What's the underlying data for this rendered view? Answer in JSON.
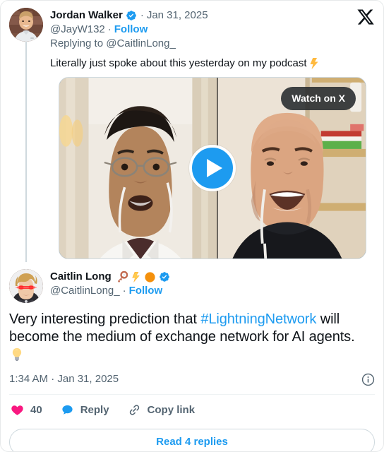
{
  "branding": {
    "logo": "x-logo"
  },
  "parent_tweet": {
    "display_name": "Jordan Walker",
    "verified": true,
    "separator": "·",
    "date": "Jan 31, 2025",
    "handle": "@JayW132",
    "follow_label": "Follow",
    "replying_to": "Replying to @CaitlinLong_",
    "body_text": "Literally just spoke about this yesterday on my podcast",
    "body_emoji": "high-voltage-emoji",
    "avatar_alt": "jordan-walker-avatar"
  },
  "video": {
    "watch_button_label": "Watch on X",
    "play_button": "play-icon",
    "left_frame_alt": "man-with-glasses-white-shirt-video-frame",
    "right_frame_alt": "bald-man-black-tshirt-video-frame"
  },
  "main_tweet": {
    "display_name": "Caitlin Long",
    "name_emojis": [
      "key-emoji",
      "high-voltage-emoji",
      "orange-circle-emoji"
    ],
    "verified": true,
    "handle": "@CaitlinLong_",
    "separator": "·",
    "follow_label": "Follow",
    "avatar_alt": "caitlin-long-avatar",
    "text_part1": "Very interesting prediction that ",
    "hashtag": "#LightningNetwork",
    "text_part2": " will become the medium of exchange network for AI agents.",
    "trailing_emoji": "light-bulb-emoji",
    "timestamp": "1:34 AM · Jan 31, 2025",
    "info_icon": "info-circle-icon"
  },
  "actions": {
    "like": {
      "icon": "heart-icon",
      "count": "40",
      "color": "#f91880"
    },
    "reply": {
      "icon": "reply-bubble-icon",
      "label": "Reply",
      "color": "#1d9bf0"
    },
    "copy_link": {
      "icon": "link-icon",
      "label": "Copy link",
      "color": "#536471"
    }
  },
  "footer": {
    "read_replies_label": "Read 4 replies"
  },
  "colors": {
    "accent": "#1d9bf0",
    "like": "#f91880",
    "text": "#0f1419",
    "muted": "#536471",
    "border": "#cfd9de"
  }
}
